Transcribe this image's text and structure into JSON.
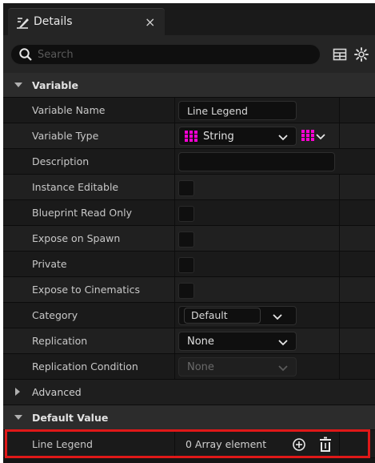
{
  "tab": {
    "label": "Details",
    "close": "×"
  },
  "search": {
    "placeholder": "Search"
  },
  "categories": {
    "variable": "Variable",
    "advanced": "Advanced",
    "default_value": "Default Value"
  },
  "properties": {
    "variable_name": {
      "label": "Variable Name",
      "value": "Line Legend"
    },
    "variable_type": {
      "label": "Variable Type",
      "value": "String"
    },
    "description": {
      "label": "Description",
      "value": ""
    },
    "instance_editable": {
      "label": "Instance Editable"
    },
    "blueprint_read_only": {
      "label": "Blueprint Read Only"
    },
    "expose_on_spawn": {
      "label": "Expose on Spawn"
    },
    "private": {
      "label": "Private"
    },
    "expose_to_cinematics": {
      "label": "Expose to Cinematics"
    },
    "category": {
      "label": "Category",
      "value": "Default"
    },
    "replication": {
      "label": "Replication",
      "value": "None"
    },
    "replication_condition": {
      "label": "Replication Condition",
      "value": "None"
    }
  },
  "default_value": {
    "label": "Line Legend",
    "value": "0 Array element"
  },
  "colors": {
    "type_string": "#ff00d4",
    "highlight": "#e01818"
  },
  "icons": {
    "tab": "details-pen-icon",
    "search": "magnifier-icon",
    "table_view": "table-icon",
    "settings": "gear-icon",
    "add": "plus-circle-icon",
    "delete": "trash-icon"
  }
}
